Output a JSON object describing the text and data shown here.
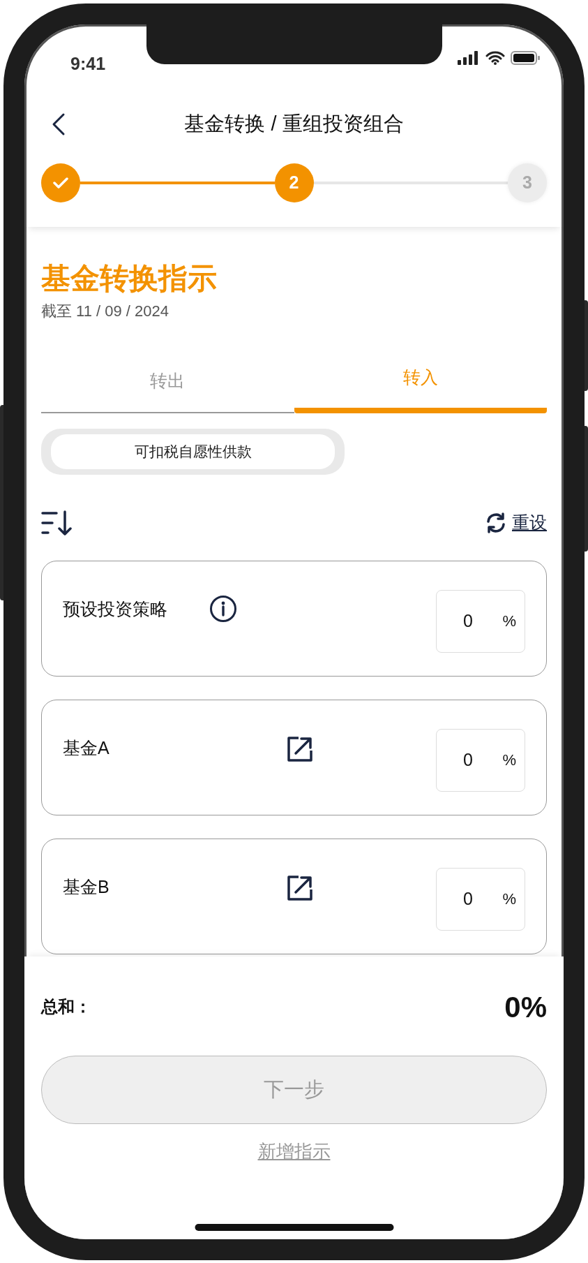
{
  "status_bar": {
    "time": "9:41"
  },
  "header": {
    "title": "基金转换 / 重组投资组合"
  },
  "stepper": [
    {
      "completed": true,
      "current": false
    },
    {
      "label": "2",
      "completed": false,
      "current": true
    },
    {
      "label": "3",
      "completed": false,
      "current": false
    }
  ],
  "heading": "基金转换指示",
  "as_of": "截至 11 / 09 / 2024",
  "tabs": [
    {
      "label": "转出",
      "selected": false
    },
    {
      "label": "转入",
      "selected": true
    }
  ],
  "chips": [
    {
      "label": "可扣税自愿性供款",
      "selected": true
    }
  ],
  "reset_link": "重设",
  "funds": [
    {
      "name": "预设投资策略",
      "kind": "info",
      "value": "0",
      "unit": "%"
    },
    {
      "name": "基金A",
      "kind": "external",
      "value": "0",
      "unit": "%"
    },
    {
      "name": "基金B",
      "kind": "external",
      "value": "0",
      "unit": "%"
    }
  ],
  "footer": {
    "total_label": "总和：",
    "total_value": "0%",
    "next_button": {
      "label": "下一步",
      "disabled": true
    },
    "add_link": "新增指示"
  }
}
